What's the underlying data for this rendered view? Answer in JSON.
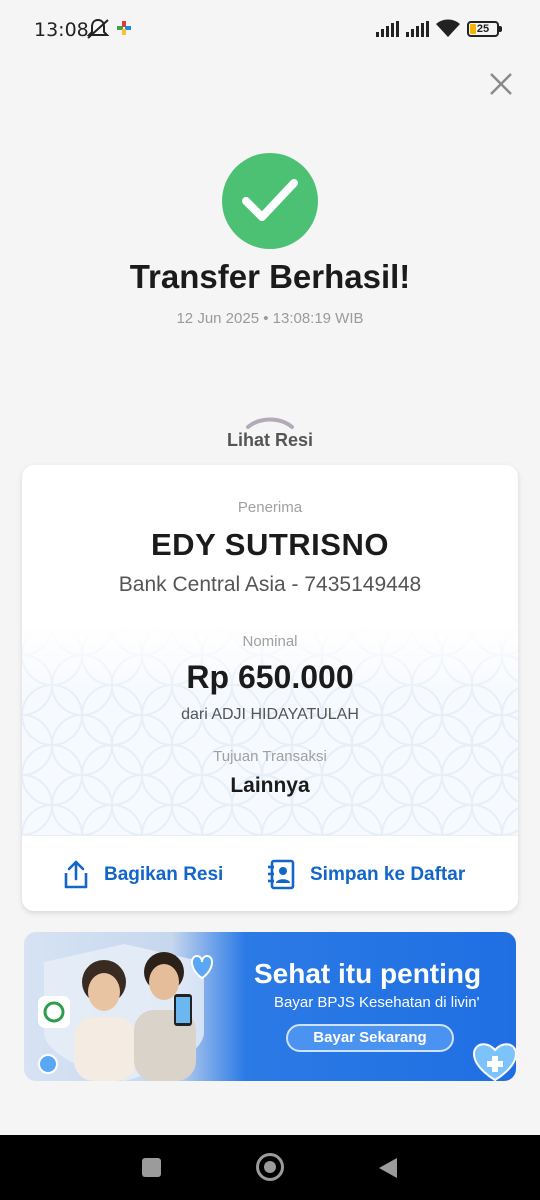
{
  "status_bar": {
    "time": "13:08",
    "battery_level": "25",
    "icons": [
      "mute-icon",
      "notification-icon",
      "signal-icon",
      "signal-icon",
      "wifi-icon",
      "battery-icon"
    ]
  },
  "header": {
    "close_icon": "close-icon"
  },
  "success": {
    "icon": "check-circle-icon",
    "title": "Transfer Berhasil!",
    "datetime": "12 Jun 2025 • 13:08:19 WIB"
  },
  "receipt_toggle": {
    "label": "Lihat Resi",
    "icon": "chevron-up-icon"
  },
  "receipt": {
    "recipient_label": "Penerima",
    "recipient_name": "EDY SUTRISNO",
    "recipient_bank": "Bank Central Asia - 7435149448",
    "amount_label": "Nominal",
    "amount": "Rp 650.000",
    "sender": "dari ADJI HIDAYATULAH",
    "purpose_label": "Tujuan Transaksi",
    "purpose": "Lainnya"
  },
  "actions": {
    "share_label": "Bagikan Resi",
    "save_label": "Simpan ke Daftar"
  },
  "banner": {
    "title": "Sehat itu penting",
    "subtitle": "Bayar BPJS Kesehatan di livin'",
    "button": "Bayar Sekarang"
  },
  "colors": {
    "success_green": "#4cc174",
    "action_blue": "#1366c9",
    "banner_blue": "#1f6fe3"
  }
}
